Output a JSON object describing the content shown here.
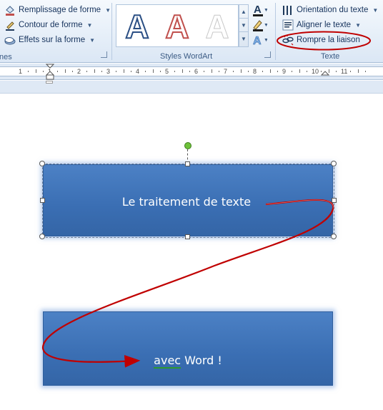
{
  "ribbon": {
    "shape_styles": {
      "fill": "Remplissage de forme",
      "outline": "Contour de forme",
      "effects": "Effets sur la forme",
      "group_label_partial": "nes"
    },
    "wordart": {
      "gallery_letter": "A",
      "group_label": "Styles WordArt"
    },
    "text": {
      "orientation": "Orientation du texte",
      "align": "Aligner le texte",
      "break_link": "Rompre la liaison",
      "group_label": "Texte"
    }
  },
  "ruler": {
    "numbers": [
      "1",
      "1",
      "2",
      "3",
      "4",
      "5",
      "6",
      "7",
      "8",
      "9",
      "10",
      "11"
    ]
  },
  "document": {
    "textbox1_text": "Le traitement de texte",
    "textbox2_word1": "avec",
    "textbox2_rest": " Word !"
  },
  "colors": {
    "textbox": "#3a6eb3",
    "annotation": "#c00000",
    "rotation_handle": "#6ec23a",
    "spelling_underline": "#2e9a2e"
  },
  "icons": [
    "paint-bucket-icon",
    "pen-outline-icon",
    "shape-effects-icon",
    "text-fill-icon",
    "text-outline-icon",
    "text-effects-icon",
    "text-direction-icon",
    "align-text-icon",
    "break-link-icon"
  ]
}
